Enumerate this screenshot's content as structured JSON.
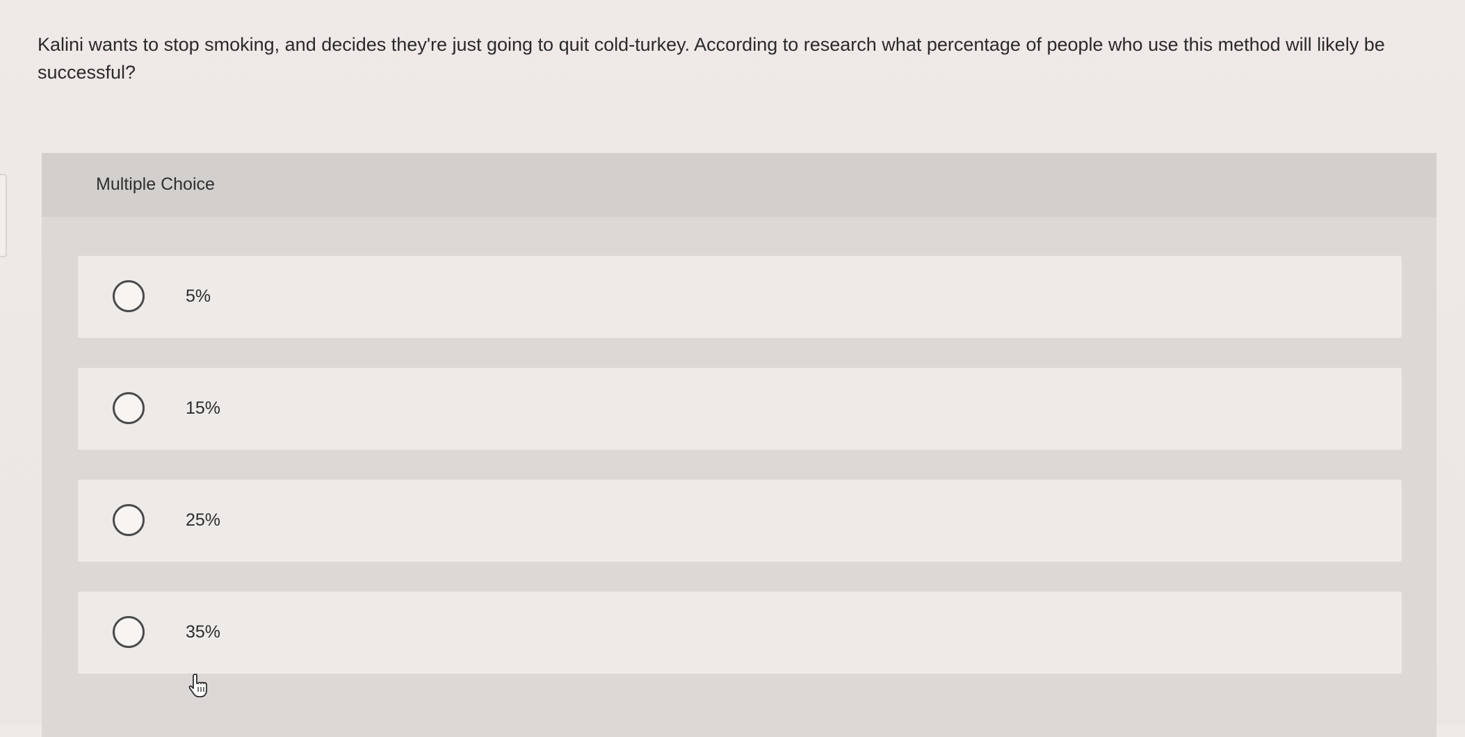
{
  "question": {
    "text": "Kalini wants to stop smoking, and decides they're just going to quit cold-turkey. According to research what percentage of people who use this method will likely be successful?"
  },
  "multiple_choice": {
    "label": "Multiple Choice",
    "options": [
      {
        "label": "5%"
      },
      {
        "label": "15%"
      },
      {
        "label": "25%"
      },
      {
        "label": "35%"
      }
    ]
  },
  "cursor": {
    "icon": "hand-pointer-icon"
  }
}
